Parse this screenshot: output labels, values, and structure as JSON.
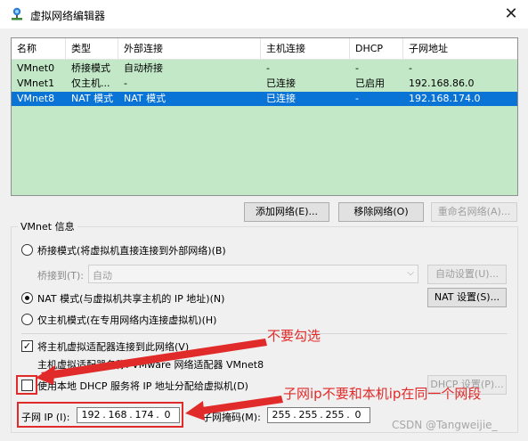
{
  "window": {
    "title": "虚拟网络编辑器",
    "close_glyph": "✕",
    "icon": "network-editor-icon"
  },
  "network_table": {
    "columns": [
      "名称",
      "类型",
      "外部连接",
      "主机连接",
      "DHCP",
      "子网地址"
    ],
    "rows": [
      {
        "name": "VMnet0",
        "type": "桥接模式",
        "external": "自动桥接",
        "host": "-",
        "dhcp": "-",
        "subnet": "-",
        "selected": false
      },
      {
        "name": "VMnet1",
        "type": "仅主机...",
        "external": "-",
        "host": "已连接",
        "dhcp": "已启用",
        "subnet": "192.168.86.0",
        "selected": false
      },
      {
        "name": "VMnet8",
        "type": "NAT 模式",
        "external": "NAT 模式",
        "host": "已连接",
        "dhcp": "-",
        "subnet": "192.168.174.0",
        "selected": true
      }
    ]
  },
  "table_buttons": {
    "add": "添加网络(E)...",
    "remove": "移除网络(O)",
    "rename": "重命名网络(A)..."
  },
  "vmnet_info": {
    "group_label": "VMnet 信息",
    "bridged_label": "桥接模式(将虚拟机直接连接到外部网络)(B)",
    "bridge_to_label": "桥接到(T):",
    "bridge_to_value": "自动",
    "auto_settings": "自动设置(U)...",
    "nat_label": "NAT 模式(与虚拟机共享主机的 IP 地址)(N)",
    "nat_settings": "NAT 设置(S)...",
    "hostonly_label": "仅主机模式(在专用网络内连接虚拟机)(H)",
    "connect_adapter_label": "将主机虚拟适配器连接到此网络(V)",
    "adapter_name": "主机虚拟适配器名称: VMware 网络适配器 VMnet8",
    "dhcp_label": "使用本地 DHCP 服务将 IP 地址分配给虚拟机(D)",
    "dhcp_settings": "DHCP 设置(P)...",
    "subnet_ip_label": "子网 IP (I):",
    "subnet_ip": [
      "192",
      "168",
      "174",
      "0"
    ],
    "mask_label": "子网掩码(M):",
    "mask": [
      "255",
      "255",
      "255",
      "0"
    ],
    "bridged_selected": false,
    "nat_selected": true,
    "hostonly_selected": false,
    "connect_adapter_checked": true,
    "dhcp_checked": false
  },
  "annotations": {
    "dont_check": "不要勾选",
    "subnet_note": "子网ip不要和本机ip在同一个网段",
    "color": "#e12a2a"
  },
  "watermark": "CSDN @Tangweijie_"
}
